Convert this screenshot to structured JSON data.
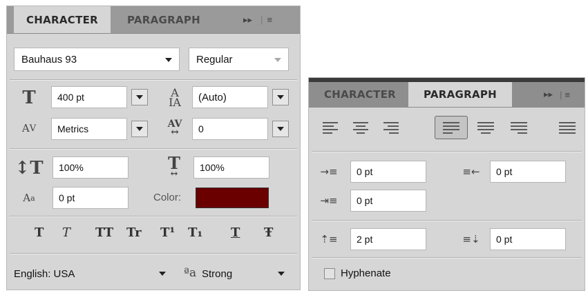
{
  "character_panel": {
    "tabs": {
      "character": "CHARACTER",
      "paragraph": "PARAGRAPH"
    },
    "tab_tools": {
      "forward": "▸▸",
      "menu": "≡"
    },
    "font_family": "Bauhaus 93",
    "font_style": "Regular",
    "font_size": "400 pt",
    "leading": "(Auto)",
    "kerning": "Metrics",
    "tracking": "0",
    "vertical_scale": "100%",
    "horizontal_scale": "100%",
    "baseline_shift": "0 pt",
    "color_label": "Color:",
    "color_value": "#6a0000",
    "style_buttons": [
      "T",
      "T",
      "TT",
      "Tr",
      "T¹",
      "T₁",
      "T",
      "Ŧ"
    ],
    "language": "English: USA",
    "aa_icon": "ªa",
    "antialias": "Strong"
  },
  "paragraph_panel": {
    "tabs": {
      "character": "CHARACTER",
      "paragraph": "PARAGRAPH"
    },
    "tab_tools": {
      "forward": "▸▸",
      "menu": "≡"
    },
    "indent_left": "0 pt",
    "indent_right": "0 pt",
    "indent_first_line": "0 pt",
    "space_before": "2 pt",
    "space_after": "0 pt",
    "hyphenate_label": "Hyphenate"
  }
}
